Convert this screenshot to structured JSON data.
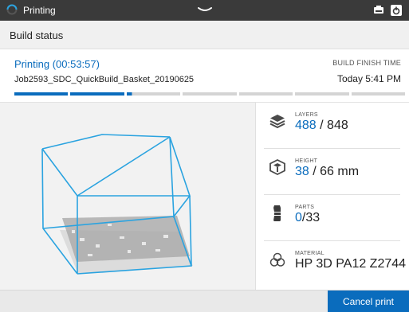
{
  "colors": {
    "accent": "#0a6cbd",
    "topbar": "#3a3a3a",
    "model_outline": "#2aa3e0"
  },
  "topbar": {
    "title": "Printing",
    "icons": [
      "spinner-icon",
      "pull-down-handle-icon",
      "printer-icon",
      "power-icon"
    ]
  },
  "header": {
    "title": "Build status"
  },
  "job": {
    "status": "Printing (00:53:57)",
    "name": "Job2593_SDC_QuickBuild_Basket_20190625",
    "finish_label": "BUILD FINISH TIME",
    "finish_value": "Today 5:41 PM",
    "progress_segments": [
      "complete",
      "complete",
      "partial",
      "pending",
      "pending",
      "pending",
      "pending"
    ],
    "partial_fill_fraction": 0.1
  },
  "stats": [
    {
      "id": "layers",
      "icon": "layers-icon",
      "label": "LAYERS",
      "current": "488",
      "total": "/ 848"
    },
    {
      "id": "height",
      "icon": "height-icon",
      "label": "HEIGHT",
      "current": "38",
      "total": "/ 66 mm"
    },
    {
      "id": "parts",
      "icon": "parts-icon",
      "label": "PARTS",
      "current": "0",
      "total": "/33"
    },
    {
      "id": "material",
      "icon": "material-icon",
      "label": "MATERIAL",
      "current": "",
      "total": "HP 3D PA12 Z2744"
    }
  ],
  "footer": {
    "cancel_label": "Cancel print"
  }
}
